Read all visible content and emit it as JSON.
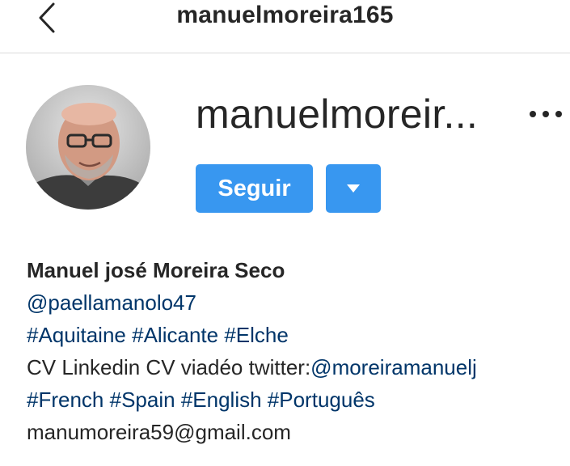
{
  "header": {
    "title": "manuelmoreira165"
  },
  "profile": {
    "username_display": "manuelmoreir...",
    "follow_label": "Seguir"
  },
  "bio": {
    "full_name": "Manuel josé Moreira Seco",
    "line_handle": "@paellamanolo47",
    "hashtags_1": [
      "#Aquitaine",
      "#Alicante",
      "#Elche"
    ],
    "line_cv_text": "CV Linkedin CV viadéo twitter:",
    "line_cv_handle": "@moreiramanuelj",
    "hashtags_2": [
      "#French",
      "#Spain",
      "#English",
      "#Português"
    ],
    "email": "manumoreira59@gmail.com"
  },
  "colors": {
    "accent": "#3897f0",
    "link": "#003569",
    "text": "#262626",
    "divider": "#dbdbdb"
  },
  "icons": [
    "chevron-left-icon",
    "more-horizontal-icon",
    "caret-down-icon"
  ]
}
